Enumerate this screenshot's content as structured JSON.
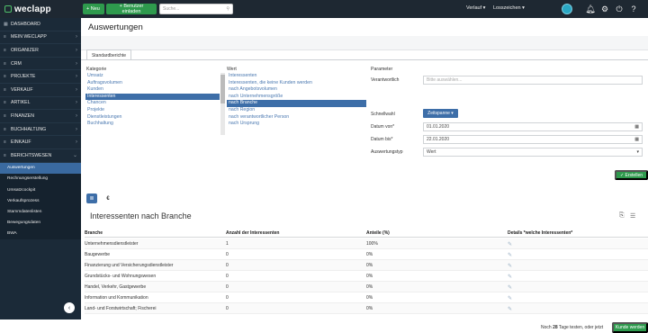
{
  "topbar": {
    "logo": "weclapp",
    "new_label": "+ Neu",
    "invite_label": "+ Benutzer einladen",
    "search_placeholder": "Suche...",
    "verlauf": "Verlauf ▾",
    "loos": "Losszeichen ▾"
  },
  "sidebar": {
    "items": [
      {
        "icon": "▦",
        "label": "DASHBOARD",
        "chevron": ""
      },
      {
        "icon": "≡",
        "label": "MEIN WECLAPP",
        "chevron": "›"
      },
      {
        "icon": "≡",
        "label": "ORGANIZER",
        "chevron": "›"
      },
      {
        "icon": "≡",
        "label": "CRM",
        "chevron": "›"
      },
      {
        "icon": "≡",
        "label": "PROJEKTE",
        "chevron": "›"
      },
      {
        "icon": "≡",
        "label": "VERKAUF",
        "chevron": "›"
      },
      {
        "icon": "≡",
        "label": "ARTIKEL",
        "chevron": "›"
      },
      {
        "icon": "≡",
        "label": "FINANZEN",
        "chevron": "›"
      },
      {
        "icon": "≡",
        "label": "BUCHHALTUNG",
        "chevron": "›"
      },
      {
        "icon": "≡",
        "label": "EINKAUF",
        "chevron": "›"
      },
      {
        "icon": "≡",
        "label": "BERICHTSWESEN",
        "chevron": "⌄"
      }
    ],
    "subitems": [
      "Auswertungen",
      "Rechnungserstellung",
      "Umsatzcockpit",
      "Verkaufsprozess",
      "Stammdatenlisten",
      "Bewegungsdaten",
      "BWA"
    ],
    "collapse": "‹"
  },
  "main": {
    "title": "Auswertungen",
    "tab": "Standardberichte",
    "kategorie_label": "Kategorie",
    "wert_label": "Wert",
    "parameter_label": "Parameter",
    "kategorien": [
      "Umsatz",
      "Auftragsvolumen",
      "Kunden",
      "Interessenten",
      "Chancen",
      "Projekte",
      "Dienstleistungen",
      "Buchhaltung"
    ],
    "kategorie_selected": 3,
    "werte": [
      "Interessenten",
      "Interessenten, die keine Kunden werden",
      "nach Angebotsvolumen",
      "nach Unternehmensgröße",
      "nach Branche",
      "nach Region",
      "nach verantwortlicher Person",
      "nach Ursprung"
    ],
    "wert_selected": 4,
    "params": {
      "verantwortlich_label": "Verantwortlich",
      "verantwortlich_placeholder": "Bitte auswählen...",
      "schnellwahl_label": "Schnellwahl",
      "zeitspanne": "Zeitspanne ▾",
      "von_label": "Datum von*",
      "von_value": "01.01.2020",
      "bis_label": "Datum bis*",
      "bis_value": "22.01.2020",
      "typ_label": "Auswertungstyp",
      "typ_value": "Wert"
    },
    "erstellen": "✓ Erstellen",
    "view_table_icon": "≣",
    "view_euro": "€",
    "report_title": "Interessenten nach Branche",
    "columns": [
      "Branche",
      "Anzahl der Interessenten",
      "Anteile (%)",
      "Details *welche Interessenten*"
    ],
    "rows": [
      [
        "Unternehmensdienstleister",
        "1",
        "100%"
      ],
      [
        "Baugewerbe",
        "0",
        "0%"
      ],
      [
        "Finanzierung und Versicherungsdienstleister",
        "0",
        "0%"
      ],
      [
        "Grundstücks- und Wohnungswesen",
        "0",
        "0%"
      ],
      [
        "Handel, Verkehr, Gastgewerbe",
        "0",
        "0%"
      ],
      [
        "Information und Kommunikation",
        "0",
        "0%"
      ],
      [
        "Land- und Forstwirtschaft; Fischerei",
        "0",
        "0%"
      ]
    ],
    "trial_prefix": "Noch ",
    "trial_days": "28",
    "trial_suffix": " Tage testen, oder jetzt",
    "kunde_werden": "Kunde werden"
  }
}
